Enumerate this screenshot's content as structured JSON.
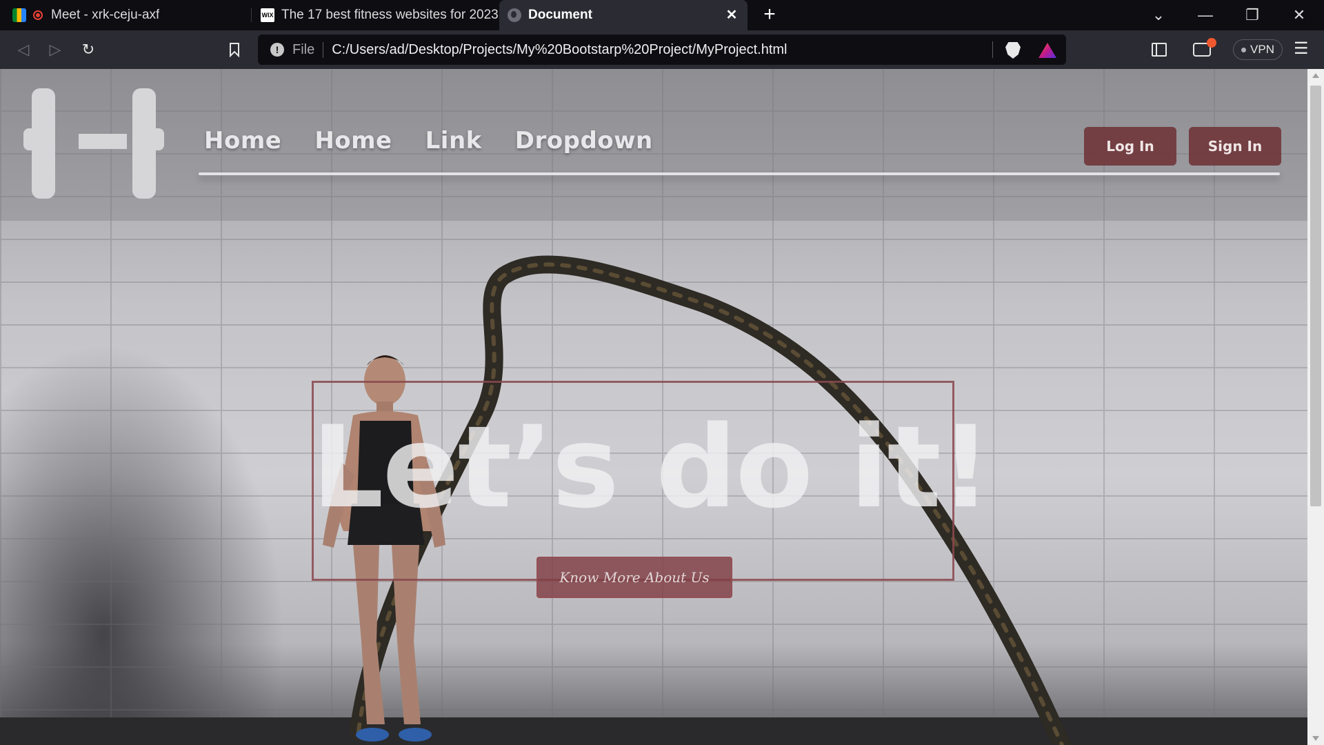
{
  "browser": {
    "tabs": [
      {
        "title": "Meet - xrk-ceju-axf",
        "icon": "google-meet-icon",
        "recording": true
      },
      {
        "title": "The 17 best fitness websites for 2023",
        "icon": "wix-icon",
        "favicon_text": "WIX"
      },
      {
        "title": "Document",
        "icon": "globe-icon",
        "active": true
      }
    ],
    "new_tab": "+",
    "close_tab": "✕",
    "window_controls": {
      "tab_search": "⌄",
      "minimize": "—",
      "restore": "❐",
      "close": "✕"
    },
    "scheme": "File",
    "url": "C:/Users/ad/Desktop/Projects/My%20Bootstarp%20Project/MyProject.html",
    "vpn_label": "VPN",
    "menu": "☰",
    "colors": {
      "tabstrip": "#0d0d12",
      "toolbar": "#2b2b33",
      "rewards_badge": "#f0582f"
    }
  },
  "site": {
    "logo": "dumbbell-logo",
    "nav": [
      {
        "label": "Home"
      },
      {
        "label": "Home"
      },
      {
        "label": "Link"
      },
      {
        "label": "Dropdown"
      }
    ],
    "login": "Log In",
    "signin": "Sign In",
    "hero": {
      "title": "Let’s do it!",
      "cta": "Know More About Us"
    },
    "colors": {
      "accent": "#703740",
      "hero_border": "#8a484e",
      "text": "#e8e8ea"
    }
  }
}
